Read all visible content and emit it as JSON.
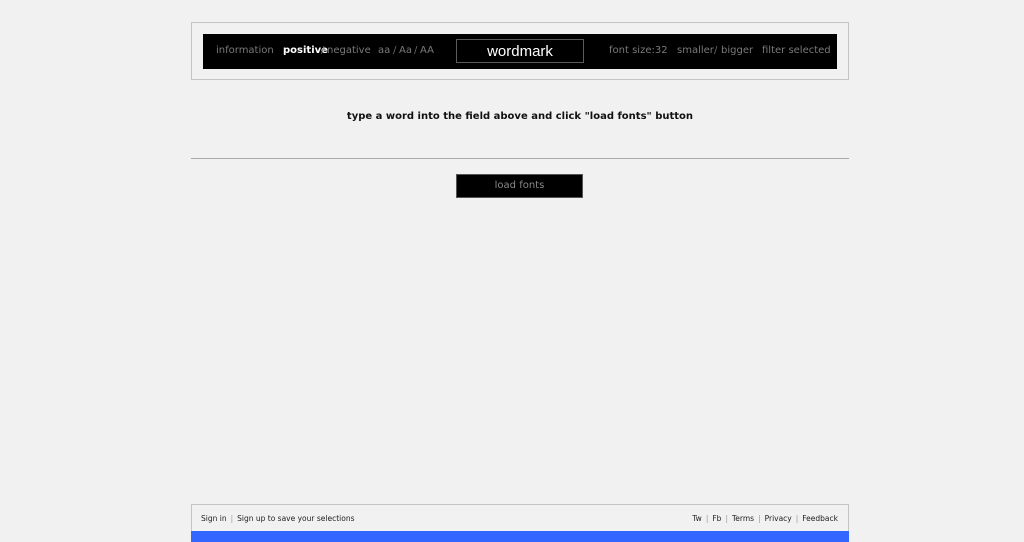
{
  "toolbar": {
    "information": "information",
    "positive": "positive",
    "slash": "/",
    "negative": "negative",
    "case_lower": "aa",
    "case_title": "Aa",
    "case_upper": "AA",
    "wordmark_value": "wordmark",
    "font_size_label": "font size:",
    "font_size_value": "32",
    "smaller": "smaller",
    "bigger": "bigger",
    "filter_selected": "filter selected"
  },
  "main": {
    "instruction": "type a word into the field above and click \"load fonts\" button",
    "load_button": "load fonts"
  },
  "footer": {
    "sign_in": "Sign in",
    "sign_up": "Sign up to save your selections",
    "links": [
      "Tw",
      "Fb",
      "Terms",
      "Privacy",
      "Feedback"
    ]
  },
  "banner": {
    "text": ""
  },
  "colors": {
    "background": "#f1f1f1",
    "toolbar": "#000000",
    "banner": "#3366ff"
  }
}
